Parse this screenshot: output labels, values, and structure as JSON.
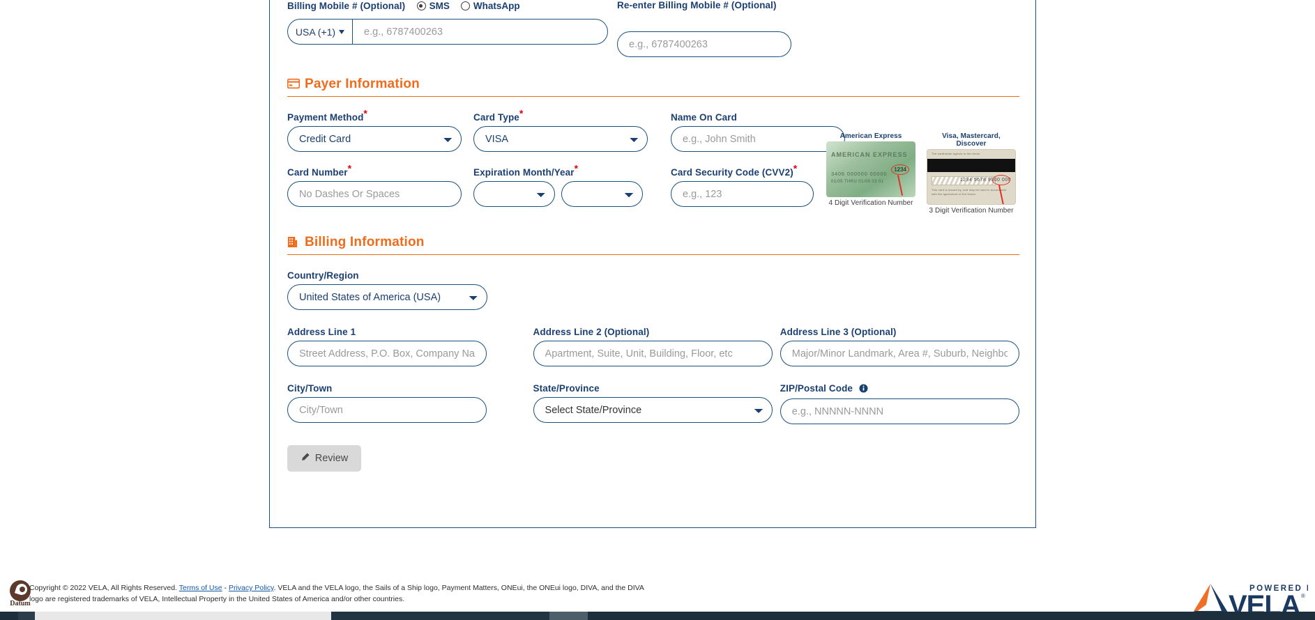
{
  "billing_mobile": {
    "label": "Billing Mobile # (Optional)",
    "radios": [
      {
        "label": "SMS",
        "selected": true
      },
      {
        "label": "WhatsApp",
        "selected": false
      }
    ],
    "country_code": "USA (+1)",
    "number_placeholder": "e.g., 6787400263",
    "reenter_label": "Re-enter Billing Mobile # (Optional)",
    "reenter_placeholder": "e.g., 6787400263"
  },
  "payer_information": {
    "section_title": "Payer Information",
    "section_icon": "credit-card-icon",
    "payment_method": {
      "label": "Payment Method",
      "required": true,
      "value": "Credit Card",
      "options": [
        "Credit Card"
      ]
    },
    "card_type": {
      "label": "Card Type",
      "required": true,
      "value": "VISA",
      "options": [
        "VISA"
      ]
    },
    "name_on_card": {
      "label": "Name On Card",
      "required": false,
      "value": "",
      "placeholder": "e.g., John Smith"
    },
    "card_number": {
      "label": "Card Number",
      "required": true,
      "value": "",
      "placeholder": "No Dashes Or Spaces"
    },
    "expiration": {
      "label": "Expiration Month/Year",
      "required": true,
      "month_value": "",
      "year_value": ""
    },
    "cvv": {
      "label": "Card Security Code (CVV2)",
      "required": true,
      "value": "",
      "placeholder": "e.g., 123",
      "help_icon": "question-mark-icon",
      "reveal_icon": "eye-icon"
    },
    "card_samples": [
      {
        "caption": "American Express",
        "footer": "4 Digit Verification Number",
        "card_brand_text": "AMERICAN EXPRESS",
        "card_number_text": "3406 000000 00000",
        "card_sub_text": "01/05  THRU 01/09      03      01",
        "cvv_text": "1234"
      },
      {
        "caption": "Visa, Mastercard, Discover",
        "footer": "3 Digit Verification Number",
        "sig_number_text": "1234 5678 9000 000",
        "cvv_text": "123"
      }
    ]
  },
  "billing_information": {
    "section_title": "Billing Information",
    "section_icon": "building-icon",
    "country": {
      "label": "Country/Region",
      "value": "United States of America (USA)",
      "options": [
        "United States of America (USA)"
      ]
    },
    "address1": {
      "label": "Address Line 1",
      "value": "",
      "placeholder": "Street Address, P.O. Box, Company Name, c/o"
    },
    "address2": {
      "label": "Address Line 2 (Optional)",
      "value": "",
      "placeholder": "Apartment, Suite, Unit, Building, Floor, etc"
    },
    "address3": {
      "label": "Address Line 3 (Optional)",
      "value": "",
      "placeholder": "Major/Minor Landmark, Area #, Suburb, Neighbor"
    },
    "city": {
      "label": "City/Town",
      "value": "",
      "placeholder": "City/Town"
    },
    "state": {
      "label": "State/Province",
      "value": "Select State/Province",
      "options": [
        "Select State/Province"
      ]
    },
    "zip": {
      "label": "ZIP/Postal Code",
      "value": "",
      "placeholder": "e.g., NNNNN-NNNN",
      "info_icon": "info-icon"
    }
  },
  "actions": {
    "review_label": "Review",
    "review_icon": "pencil-icon"
  },
  "footer": {
    "logo_name": "Datum",
    "copyright_part1": "Copyright © 2022 VELA, All Rights Reserved. ",
    "terms_link": "Terms of Use",
    "separator": " - ",
    "privacy_link": "Privacy Policy",
    "copyright_part2": ". VELA and the VELA logo, the Sails of a Ship logo, Payment Matters, ONEui, the ONEui logo, DIVA, and the DIVA logo are registered trademarks of VELA, Intellectual Property in the United States of America and/or other countries.",
    "vela_powered_by": "POWERED BY",
    "vela_wordmark": "VELA"
  },
  "colors": {
    "accent_orange": "#ee6c1b",
    "label_blue": "#1b3f72",
    "border_blue": "#18507f",
    "required_red": "#e8000d",
    "vela_navy": "#1b3a62",
    "vela_orange": "#ef6f26"
  }
}
